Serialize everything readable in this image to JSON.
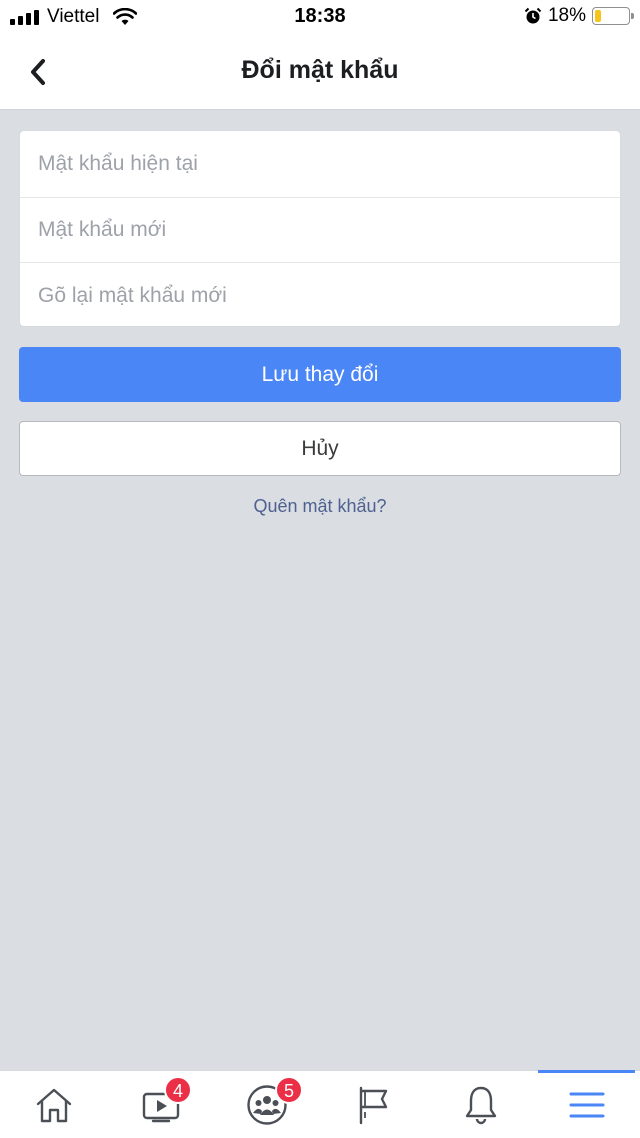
{
  "status_bar": {
    "carrier": "Viettel",
    "time": "18:38",
    "battery_percent": "18%",
    "battery_level": 0.18,
    "icons": [
      "signal-icon",
      "wifi-icon",
      "alarm-icon",
      "battery-icon"
    ]
  },
  "header": {
    "title": "Đổi mật khẩu",
    "back_icon": "chevron-left-icon"
  },
  "form": {
    "current_password_placeholder": "Mật khẩu hiện tại",
    "new_password_placeholder": "Mật khẩu mới",
    "confirm_password_placeholder": "Gõ lại mật khẩu mới"
  },
  "actions": {
    "save_label": "Lưu thay đổi",
    "cancel_label": "Hủy",
    "forgot_label": "Quên mật khẩu?"
  },
  "tab_bar": {
    "items": [
      {
        "name": "home",
        "icon": "home-icon",
        "badge": ""
      },
      {
        "name": "watch",
        "icon": "video-icon",
        "badge": "4"
      },
      {
        "name": "groups",
        "icon": "groups-icon",
        "badge": "5"
      },
      {
        "name": "pages",
        "icon": "flag-icon",
        "badge": ""
      },
      {
        "name": "notifications",
        "icon": "bell-icon",
        "badge": ""
      },
      {
        "name": "menu",
        "icon": "menu-icon",
        "badge": "",
        "active": true
      }
    ]
  },
  "colors": {
    "primary": "#4a86f5",
    "background": "#dadde2",
    "link": "#4e6190",
    "badge": "#ea2f46",
    "battery": "#f5c518"
  }
}
